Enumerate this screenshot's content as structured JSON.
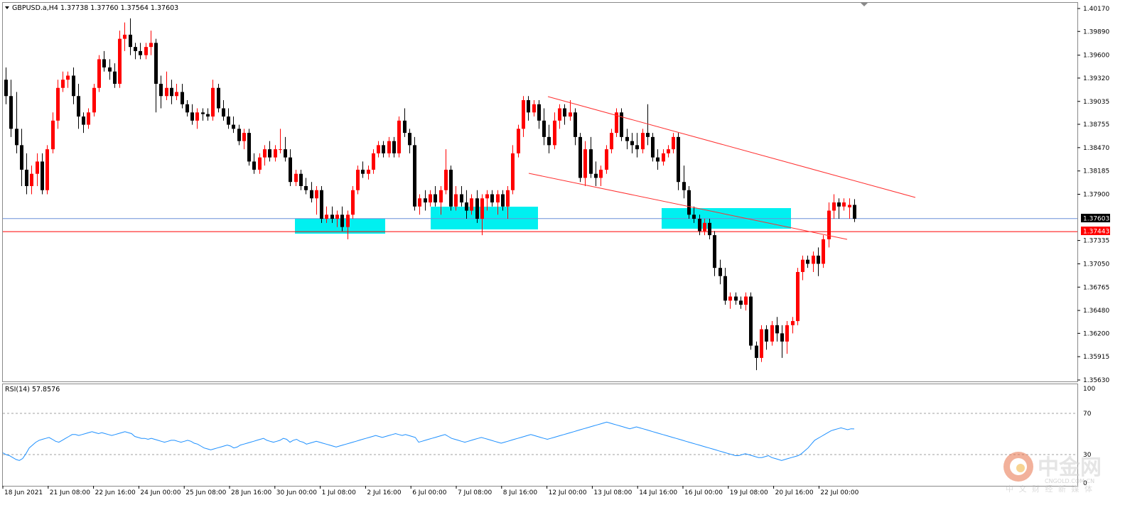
{
  "header": {
    "symbol": "GBPUSD.a,H4",
    "ohlc": "1.37738 1.37760 1.37564 1.37603"
  },
  "price_axis": {
    "ticks": [
      "1.40170",
      "1.39890",
      "1.39600",
      "1.39320",
      "1.39035",
      "1.38755",
      "1.38470",
      "1.38185",
      "1.37900",
      "1.37335",
      "1.37050",
      "1.36765",
      "1.36480",
      "1.36200",
      "1.35915",
      "1.35630"
    ],
    "current_price_label": "1.37603",
    "level_label": "1.37443"
  },
  "rsi_panel": {
    "title": "RSI(14) 57.8576",
    "ticks": [
      "100",
      "70",
      "30",
      "0"
    ]
  },
  "time_axis": {
    "labels": [
      "18 Jun 2021",
      "21 Jun 08:00",
      "22 Jun 16:00",
      "24 Jun 00:00",
      "25 Jun 08:00",
      "28 Jun 16:00",
      "30 Jun 00:00",
      "1 Jul 08:00",
      "2 Jul 16:00",
      "6 Jul 00:00",
      "7 Jul 08:00",
      "8 Jul 16:00",
      "12 Jul 00:00",
      "13 Jul 08:00",
      "14 Jul 16:00",
      "16 Jul 00:00",
      "19 Jul 08:00",
      "20 Jul 16:00",
      "22 Jul 00:00"
    ]
  },
  "watermark": {
    "name": "中金网",
    "domain": "CNGOLD.COM.CN",
    "tagline": "中 文 财 经 新 媒 体"
  },
  "colors": {
    "bull": "#ff0000",
    "bear": "#000000",
    "zone": "#00f0f0",
    "level_line": "#ff0000",
    "current_line": "#6a8fd8",
    "rsi_line": "#1e90ff",
    "grid_dash": "#a0a0a0"
  },
  "chart_data": {
    "type": "candlestick",
    "symbol": "GBPUSD.a",
    "timeframe": "H4",
    "ylim": [
      1.3563,
      1.4017
    ],
    "current_price": 1.37603,
    "horizontal_level": 1.37443,
    "candles": [
      [
        1.393,
        1.3945,
        1.39,
        1.391
      ],
      [
        1.391,
        1.393,
        1.386,
        1.387
      ],
      [
        1.387,
        1.3915,
        1.384,
        1.385
      ],
      [
        1.385,
        1.387,
        1.38,
        1.382
      ],
      [
        1.382,
        1.384,
        1.379,
        1.38
      ],
      [
        1.38,
        1.3825,
        1.379,
        1.3815
      ],
      [
        1.3815,
        1.384,
        1.38,
        1.383
      ],
      [
        1.383,
        1.384,
        1.379,
        1.3795
      ],
      [
        1.3795,
        1.385,
        1.379,
        1.3845
      ],
      [
        1.3845,
        1.389,
        1.384,
        1.388
      ],
      [
        1.388,
        1.393,
        1.387,
        1.392
      ],
      [
        1.392,
        1.394,
        1.3915,
        1.393
      ],
      [
        1.393,
        1.394,
        1.392,
        1.3935
      ],
      [
        1.3935,
        1.3945,
        1.39,
        1.391
      ],
      [
        1.391,
        1.3925,
        1.387,
        1.3885
      ],
      [
        1.3885,
        1.389,
        1.3865,
        1.3875
      ],
      [
        1.3875,
        1.3895,
        1.387,
        1.389
      ],
      [
        1.389,
        1.3925,
        1.3885,
        1.392
      ],
      [
        1.392,
        1.396,
        1.3915,
        1.3955
      ],
      [
        1.3955,
        1.3965,
        1.394,
        1.3945
      ],
      [
        1.3945,
        1.3955,
        1.393,
        1.394
      ],
      [
        1.394,
        1.395,
        1.392,
        1.3925
      ],
      [
        1.3925,
        1.399,
        1.392,
        1.398
      ],
      [
        1.398,
        1.4,
        1.3965,
        1.3985
      ],
      [
        1.3985,
        1.4005,
        1.396,
        1.397
      ],
      [
        1.397,
        1.3975,
        1.3955,
        1.3965
      ],
      [
        1.3965,
        1.3975,
        1.3955,
        1.396
      ],
      [
        1.396,
        1.3975,
        1.3955,
        1.397
      ],
      [
        1.397,
        1.399,
        1.396,
        1.3975
      ],
      [
        1.3975,
        1.398,
        1.389,
        1.3925
      ],
      [
        1.3925,
        1.3935,
        1.3895,
        1.391
      ],
      [
        1.391,
        1.394,
        1.3905,
        1.392
      ],
      [
        1.392,
        1.393,
        1.39,
        1.391
      ],
      [
        1.391,
        1.3925,
        1.3905,
        1.3915
      ],
      [
        1.3915,
        1.3925,
        1.3895,
        1.39
      ],
      [
        1.39,
        1.3905,
        1.3885,
        1.389
      ],
      [
        1.389,
        1.39,
        1.3875,
        1.388
      ],
      [
        1.388,
        1.3895,
        1.387,
        1.389
      ],
      [
        1.389,
        1.3895,
        1.388,
        1.3888
      ],
      [
        1.3888,
        1.3895,
        1.388,
        1.3885
      ],
      [
        1.3885,
        1.393,
        1.388,
        1.392
      ],
      [
        1.392,
        1.3925,
        1.389,
        1.3895
      ],
      [
        1.3895,
        1.3905,
        1.388,
        1.3885
      ],
      [
        1.3885,
        1.3895,
        1.387,
        1.3875
      ],
      [
        1.3875,
        1.3885,
        1.3865,
        1.387
      ],
      [
        1.387,
        1.3875,
        1.385,
        1.3855
      ],
      [
        1.3855,
        1.387,
        1.3845,
        1.3865
      ],
      [
        1.3865,
        1.387,
        1.3825,
        1.383
      ],
      [
        1.383,
        1.384,
        1.3815,
        1.382
      ],
      [
        1.382,
        1.384,
        1.3815,
        1.3835
      ],
      [
        1.3835,
        1.385,
        1.3825,
        1.3845
      ],
      [
        1.3845,
        1.3855,
        1.383,
        1.3835
      ],
      [
        1.3835,
        1.385,
        1.383,
        1.3845
      ],
      [
        1.3845,
        1.387,
        1.384,
        1.3845
      ],
      [
        1.3845,
        1.386,
        1.383,
        1.3835
      ],
      [
        1.3835,
        1.3845,
        1.38,
        1.3805
      ],
      [
        1.3805,
        1.382,
        1.38,
        1.3815
      ],
      [
        1.3815,
        1.382,
        1.3795,
        1.38
      ],
      [
        1.38,
        1.381,
        1.379,
        1.3795
      ],
      [
        1.3795,
        1.3805,
        1.378,
        1.3785
      ],
      [
        1.3785,
        1.38,
        1.3765,
        1.3795
      ],
      [
        1.3795,
        1.38,
        1.3755,
        1.376
      ],
      [
        1.376,
        1.3775,
        1.3755,
        1.3765
      ],
      [
        1.3765,
        1.3775,
        1.3755,
        1.376
      ],
      [
        1.376,
        1.377,
        1.375,
        1.3765
      ],
      [
        1.3765,
        1.3775,
        1.3745,
        1.375
      ],
      [
        1.375,
        1.377,
        1.3735,
        1.3765
      ],
      [
        1.3765,
        1.38,
        1.376,
        1.3795
      ],
      [
        1.3795,
        1.3825,
        1.379,
        1.382
      ],
      [
        1.382,
        1.383,
        1.381,
        1.3815
      ],
      [
        1.3815,
        1.3825,
        1.3808,
        1.382
      ],
      [
        1.382,
        1.3845,
        1.3815,
        1.384
      ],
      [
        1.384,
        1.3855,
        1.3835,
        1.385
      ],
      [
        1.385,
        1.3855,
        1.3835,
        1.384
      ],
      [
        1.384,
        1.386,
        1.3835,
        1.3855
      ],
      [
        1.3855,
        1.386,
        1.3835,
        1.384
      ],
      [
        1.384,
        1.3885,
        1.3835,
        1.388
      ],
      [
        1.388,
        1.3895,
        1.386,
        1.3865
      ],
      [
        1.3865,
        1.387,
        1.384,
        1.385
      ],
      [
        1.385,
        1.386,
        1.377,
        1.3775
      ],
      [
        1.3775,
        1.379,
        1.3765,
        1.3785
      ],
      [
        1.3785,
        1.3795,
        1.377,
        1.378
      ],
      [
        1.378,
        1.3795,
        1.3775,
        1.379
      ],
      [
        1.379,
        1.38,
        1.3775,
        1.378
      ],
      [
        1.378,
        1.38,
        1.3765,
        1.3795
      ],
      [
        1.3795,
        1.3845,
        1.379,
        1.382
      ],
      [
        1.382,
        1.3825,
        1.377,
        1.3775
      ],
      [
        1.3775,
        1.38,
        1.377,
        1.379
      ],
      [
        1.379,
        1.38,
        1.3775,
        1.378
      ],
      [
        1.378,
        1.3795,
        1.376,
        1.377
      ],
      [
        1.377,
        1.379,
        1.3765,
        1.3785
      ],
      [
        1.3785,
        1.3795,
        1.3755,
        1.376
      ],
      [
        1.376,
        1.379,
        1.374,
        1.3785
      ],
      [
        1.3785,
        1.3795,
        1.377,
        1.379
      ],
      [
        1.379,
        1.3795,
        1.3775,
        1.378
      ],
      [
        1.378,
        1.3795,
        1.3765,
        1.379
      ],
      [
        1.379,
        1.3795,
        1.377,
        1.3775
      ],
      [
        1.3775,
        1.38,
        1.376,
        1.3795
      ],
      [
        1.3795,
        1.385,
        1.379,
        1.384
      ],
      [
        1.384,
        1.3875,
        1.3835,
        1.387
      ],
      [
        1.387,
        1.391,
        1.386,
        1.3905
      ],
      [
        1.3905,
        1.391,
        1.388,
        1.389
      ],
      [
        1.389,
        1.3905,
        1.3885,
        1.39
      ],
      [
        1.39,
        1.3905,
        1.387,
        1.388
      ],
      [
        1.388,
        1.3895,
        1.385,
        1.386
      ],
      [
        1.386,
        1.3875,
        1.384,
        1.385
      ],
      [
        1.385,
        1.389,
        1.3845,
        1.388
      ],
      [
        1.388,
        1.39,
        1.387,
        1.3895
      ],
      [
        1.3895,
        1.39,
        1.3875,
        1.3885
      ],
      [
        1.3885,
        1.3905,
        1.388,
        1.389
      ],
      [
        1.389,
        1.3895,
        1.385,
        1.386
      ],
      [
        1.386,
        1.3865,
        1.3805,
        1.381
      ],
      [
        1.381,
        1.3855,
        1.38,
        1.3845
      ],
      [
        1.3845,
        1.386,
        1.381,
        1.3815
      ],
      [
        1.3815,
        1.383,
        1.38,
        1.381
      ],
      [
        1.381,
        1.3825,
        1.38,
        1.382
      ],
      [
        1.382,
        1.385,
        1.3815,
        1.3845
      ],
      [
        1.3845,
        1.387,
        1.384,
        1.3865
      ],
      [
        1.3865,
        1.3895,
        1.386,
        1.389
      ],
      [
        1.389,
        1.3895,
        1.3855,
        1.386
      ],
      [
        1.386,
        1.387,
        1.3845,
        1.3855
      ],
      [
        1.3855,
        1.3865,
        1.384,
        1.385
      ],
      [
        1.385,
        1.3865,
        1.3835,
        1.3845
      ],
      [
        1.3845,
        1.387,
        1.384,
        1.3865
      ],
      [
        1.3865,
        1.39,
        1.385,
        1.386
      ],
      [
        1.386,
        1.3865,
        1.383,
        1.3835
      ],
      [
        1.3835,
        1.3845,
        1.382,
        1.383
      ],
      [
        1.383,
        1.3845,
        1.3825,
        1.384
      ],
      [
        1.384,
        1.385,
        1.3835,
        1.3845
      ],
      [
        1.3845,
        1.3865,
        1.384,
        1.386
      ],
      [
        1.386,
        1.3865,
        1.3795,
        1.3805
      ],
      [
        1.3805,
        1.3825,
        1.3785,
        1.3795
      ],
      [
        1.3795,
        1.38,
        1.376,
        1.3765
      ],
      [
        1.3765,
        1.3775,
        1.3755,
        1.376
      ],
      [
        1.376,
        1.3765,
        1.374,
        1.3745
      ],
      [
        1.3745,
        1.376,
        1.374,
        1.3755
      ],
      [
        1.3755,
        1.376,
        1.3735,
        1.374
      ],
      [
        1.374,
        1.3745,
        1.369,
        1.37
      ],
      [
        1.37,
        1.371,
        1.368,
        1.369
      ],
      [
        1.369,
        1.37,
        1.3655,
        1.366
      ],
      [
        1.366,
        1.367,
        1.365,
        1.3665
      ],
      [
        1.3665,
        1.367,
        1.3655,
        1.366
      ],
      [
        1.366,
        1.3665,
        1.365,
        1.3655
      ],
      [
        1.3655,
        1.367,
        1.3648,
        1.3665
      ],
      [
        1.3665,
        1.367,
        1.36,
        1.3605
      ],
      [
        1.3605,
        1.361,
        1.3575,
        1.359
      ],
      [
        1.359,
        1.363,
        1.3585,
        1.3625
      ],
      [
        1.3625,
        1.363,
        1.36,
        1.361
      ],
      [
        1.361,
        1.3635,
        1.3605,
        1.363
      ],
      [
        1.363,
        1.364,
        1.361,
        1.362
      ],
      [
        1.362,
        1.363,
        1.359,
        1.361
      ],
      [
        1.361,
        1.3635,
        1.3595,
        1.363
      ],
      [
        1.363,
        1.364,
        1.362,
        1.3635
      ],
      [
        1.3635,
        1.37,
        1.363,
        1.3695
      ],
      [
        1.3695,
        1.3715,
        1.3685,
        1.371
      ],
      [
        1.371,
        1.3715,
        1.37,
        1.3705
      ],
      [
        1.3705,
        1.372,
        1.3695,
        1.3715
      ],
      [
        1.3715,
        1.3725,
        1.369,
        1.3705
      ],
      [
        1.3705,
        1.374,
        1.37,
        1.3735
      ],
      [
        1.3735,
        1.378,
        1.3725,
        1.377
      ],
      [
        1.377,
        1.379,
        1.376,
        1.378
      ],
      [
        1.378,
        1.3785,
        1.376,
        1.3775
      ],
      [
        1.3775,
        1.3785,
        1.377,
        1.378
      ],
      [
        1.3774,
        1.3785,
        1.376,
        1.3777
      ],
      [
        1.3777,
        1.3784,
        1.3756,
        1.376
      ]
    ],
    "rsi": {
      "period": 14,
      "value": 57.8576,
      "ylim": [
        0,
        100
      ],
      "levels": [
        70,
        30
      ],
      "values": [
        33,
        31,
        30,
        28,
        26,
        25,
        27,
        32,
        38,
        41,
        44,
        46,
        47,
        48,
        49,
        47,
        45,
        44,
        46,
        48,
        50,
        52,
        52,
        51,
        52,
        53,
        54,
        55,
        54,
        53,
        54,
        53,
        52,
        51,
        52,
        53,
        54,
        55,
        54,
        53,
        50,
        49,
        48,
        48,
        47,
        48,
        47,
        46,
        45,
        44,
        45,
        46,
        46,
        45,
        44,
        45,
        46,
        45,
        43,
        42,
        40,
        38,
        37,
        36,
        37,
        38,
        39,
        40,
        41,
        40,
        38,
        39,
        41,
        42,
        43,
        44,
        45,
        46,
        47,
        48,
        46,
        45,
        44,
        45,
        46,
        48,
        47,
        44,
        46,
        47,
        45,
        44,
        42,
        43,
        44,
        45,
        44,
        43,
        42,
        41,
        40,
        39,
        40,
        41,
        42,
        43,
        44,
        45,
        46,
        47,
        48,
        49,
        50,
        51,
        50,
        49,
        50,
        51,
        52,
        53,
        52,
        51,
        52,
        51,
        50,
        49,
        44,
        45,
        46,
        47,
        48,
        49,
        50,
        51,
        52,
        50,
        48,
        47,
        46,
        45,
        44,
        45,
        46,
        47,
        48,
        49,
        48,
        47,
        46,
        45,
        44,
        43,
        44,
        45,
        46,
        47,
        48,
        49,
        50,
        51,
        52,
        51,
        50,
        49,
        48,
        47,
        48,
        49,
        50,
        51,
        52,
        53,
        54,
        55,
        56,
        57,
        58,
        59,
        60,
        61,
        62,
        63,
        64,
        65,
        64,
        63,
        62,
        61,
        60,
        59,
        58,
        59,
        60,
        59,
        58,
        57,
        56,
        55,
        54,
        53,
        52,
        51,
        50,
        49,
        48,
        47,
        46,
        45,
        44,
        43,
        42,
        41,
        40,
        39,
        38,
        37,
        36,
        35,
        34,
        33,
        32,
        31,
        30,
        30,
        31,
        32,
        31,
        30,
        29,
        28,
        28,
        29,
        30,
        28,
        27,
        26,
        25,
        26,
        27,
        28,
        29,
        30,
        32,
        35,
        38,
        42,
        46,
        48,
        50,
        52,
        54,
        56,
        57,
        58,
        59,
        58,
        57,
        58,
        57.8576
      ]
    }
  }
}
